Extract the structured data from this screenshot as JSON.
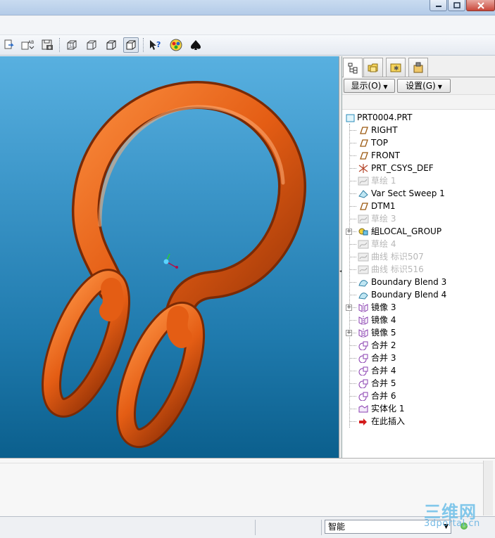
{
  "window": {
    "title": "",
    "controls": [
      "minimize",
      "maximize",
      "close"
    ]
  },
  "toolbar": {
    "buttons": [
      {
        "icon": "insert-icon"
      },
      {
        "icon": "copy-ab-icon"
      },
      {
        "icon": "save-snapshot-icon"
      },
      {
        "icon": "no-hidden-display-icon"
      },
      {
        "icon": "hidden-line-icon"
      },
      {
        "icon": "wireframe-icon"
      },
      {
        "icon": "shading-icon",
        "active": true
      },
      {
        "icon": "whats-this-help-icon"
      },
      {
        "icon": "model-color-icon"
      },
      {
        "icon": "spade-icon"
      }
    ]
  },
  "viewport": {
    "model_color": "#e8601a",
    "background_top": "#58b0e0",
    "background_bottom": "#0b5f8d"
  },
  "navigator": {
    "tabs": [
      "model-tree-tab",
      "folder-browser-tab",
      "favorites-tab",
      "connections-tab"
    ],
    "show_button": "显示(O)",
    "settings_button": "设置(G)",
    "tree": [
      {
        "label": "PRT0004.PRT",
        "icon": "part-icon",
        "root": true
      },
      {
        "label": "RIGHT",
        "icon": "datum-plane-icon"
      },
      {
        "label": "TOP",
        "icon": "datum-plane-icon"
      },
      {
        "label": "FRONT",
        "icon": "datum-plane-icon"
      },
      {
        "label": "PRT_CSYS_DEF",
        "icon": "coordinate-system-icon"
      },
      {
        "label": "草绘 1",
        "icon": "sketch-icon",
        "dim": true
      },
      {
        "label": "Var Sect Sweep 1",
        "icon": "sweep-icon"
      },
      {
        "label": "DTM1",
        "icon": "datum-plane-icon"
      },
      {
        "label": "草绘 3",
        "icon": "sketch-icon",
        "dim": true
      },
      {
        "label": "組LOCAL_GROUP",
        "icon": "group-icon",
        "expandable": true
      },
      {
        "label": "草绘 4",
        "icon": "sketch-icon",
        "dim": true
      },
      {
        "label": "曲线 标识507",
        "icon": "curve-icon",
        "dim": true
      },
      {
        "label": "曲线 标识516",
        "icon": "curve-icon",
        "dim": true
      },
      {
        "label": "Boundary Blend 3",
        "icon": "boundary-blend-icon"
      },
      {
        "label": "Boundary Blend 4",
        "icon": "boundary-blend-icon"
      },
      {
        "label": "镜像 3",
        "icon": "mirror-icon",
        "expandable": true
      },
      {
        "label": "镜像 4",
        "icon": "mirror-icon"
      },
      {
        "label": "镜像 5",
        "icon": "mirror-icon",
        "expandable": true
      },
      {
        "label": "合并 2",
        "icon": "merge-icon"
      },
      {
        "label": "合并 3",
        "icon": "merge-icon"
      },
      {
        "label": "合并 4",
        "icon": "merge-icon"
      },
      {
        "label": "合并 5",
        "icon": "merge-icon"
      },
      {
        "label": "合并 6",
        "icon": "merge-icon"
      },
      {
        "label": "实体化 1",
        "icon": "solidify-icon"
      },
      {
        "label": "在此插入",
        "icon": "insert-here-arrow-icon"
      }
    ]
  },
  "statusbar": {
    "filter_value": "智能"
  },
  "watermark": {
    "title": "三维网",
    "url": "3dportal.cn"
  }
}
